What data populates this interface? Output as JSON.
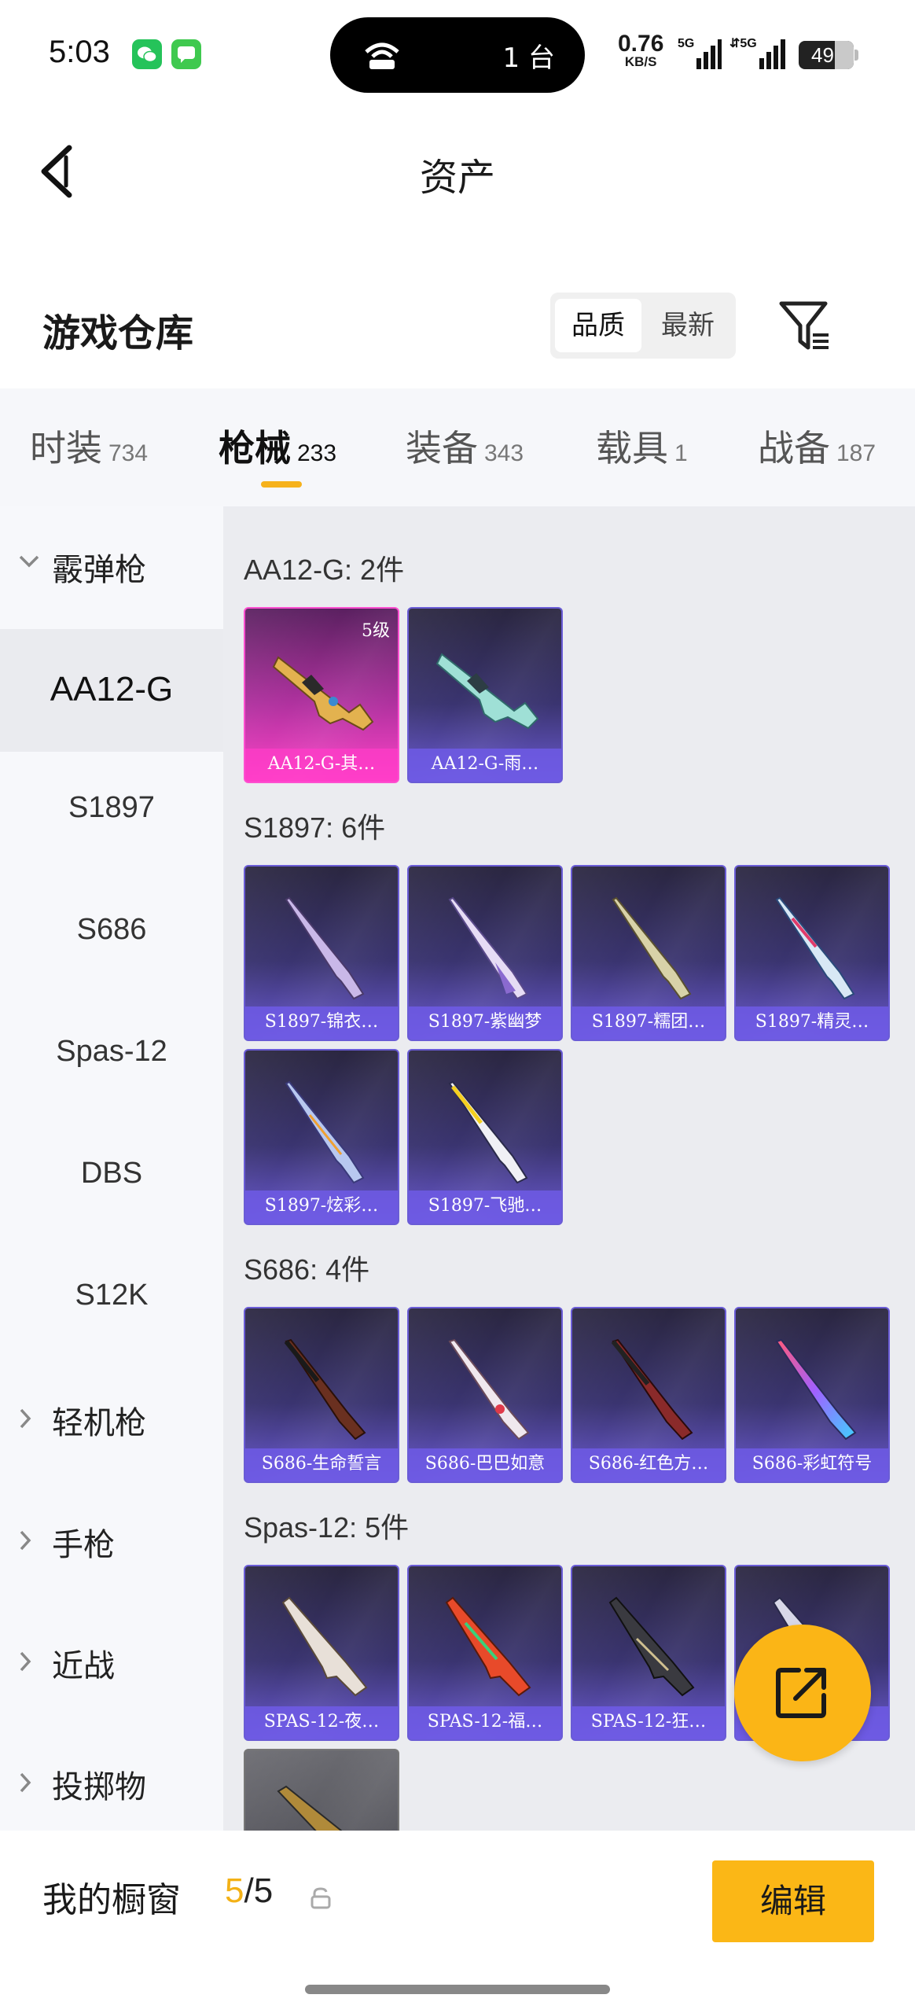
{
  "status_bar": {
    "time": "5:03",
    "hotspot_count": "1 台",
    "net_speed": "0.76",
    "net_unit": "KB/S",
    "signal1": "5G",
    "signal2": "5G",
    "battery": "49"
  },
  "header": {
    "title": "资产"
  },
  "warehouse": {
    "title": "游戏仓库",
    "sort_quality": "品质",
    "sort_newest": "最新"
  },
  "tabs": [
    {
      "label": "时装",
      "count": "734"
    },
    {
      "label": "枪械",
      "count": "233"
    },
    {
      "label": "装备",
      "count": "343"
    },
    {
      "label": "载具",
      "count": "1"
    },
    {
      "label": "战备",
      "count": "187"
    }
  ],
  "sidebar": {
    "group_shotgun": "霰弹枪",
    "items": [
      "AA12-G",
      "S1897",
      "S686",
      "Spas-12",
      "DBS",
      "S12K"
    ],
    "group_lmg": "轻机枪",
    "group_pistol": "手枪",
    "group_melee": "近战",
    "group_throw": "投掷物"
  },
  "sections": [
    {
      "title": "AA12-G: 2件",
      "cards": [
        {
          "name": "AA12-G-其…",
          "level": "5级"
        },
        {
          "name": "AA12-G-雨…"
        }
      ]
    },
    {
      "title": "S1897: 6件",
      "cards": [
        {
          "name": "S1897-锦衣…"
        },
        {
          "name": "S1897-紫幽梦"
        },
        {
          "name": "S1897-糯团…"
        },
        {
          "name": "S1897-精灵…"
        },
        {
          "name": "S1897-炫彩…"
        },
        {
          "name": "S1897-飞驰…"
        }
      ]
    },
    {
      "title": "S686: 4件",
      "cards": [
        {
          "name": "S686-生命誓言"
        },
        {
          "name": "S686-巴巴如意"
        },
        {
          "name": "S686-红色方…"
        },
        {
          "name": "S686-彩虹符号"
        }
      ]
    },
    {
      "title": "Spas-12: 5件",
      "cards": [
        {
          "name": "SPAS-12-夜…"
        },
        {
          "name": "SPAS-12-福…"
        },
        {
          "name": "SPAS-12-狂…"
        },
        {
          "name": "…"
        }
      ]
    }
  ],
  "showcase": {
    "label": "我的橱窗",
    "current": "5",
    "total": "/5",
    "edit": "编辑"
  },
  "colors": {
    "accent": "#fbb516",
    "card_purple": "#6a5cd6",
    "card_pink": "#ff4fd0"
  }
}
